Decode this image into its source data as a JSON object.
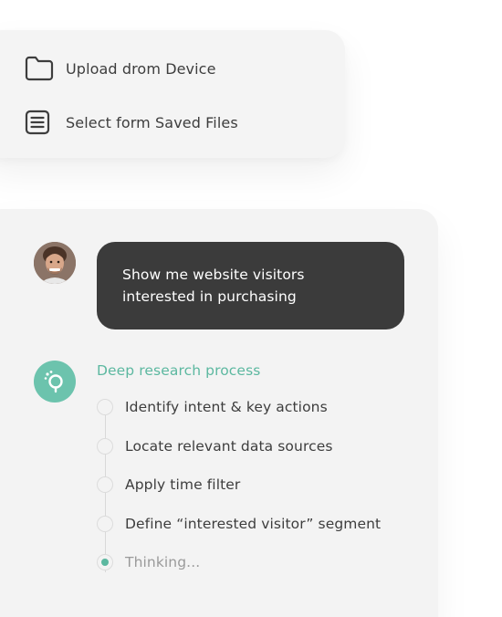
{
  "menu": {
    "items": [
      {
        "label": "Upload drom Device",
        "icon": "folder-icon"
      },
      {
        "label": "Select form Saved Files",
        "icon": "document-icon"
      }
    ]
  },
  "chat": {
    "user_message": "Show me website visitors interested in purchasing",
    "agent": {
      "icon": "research-agent-icon",
      "accent": "#5cb8a0",
      "process_title": "Deep research process",
      "steps": [
        {
          "label": "Identify intent & key actions",
          "state": "pending"
        },
        {
          "label": "Locate relevant data sources",
          "state": "pending"
        },
        {
          "label": "Apply time filter",
          "state": "pending"
        },
        {
          "label": "Define “interested visitor” segment",
          "state": "pending"
        },
        {
          "label": "Thinking...",
          "state": "active"
        }
      ]
    },
    "bubble_color": "#3b3b3b"
  }
}
